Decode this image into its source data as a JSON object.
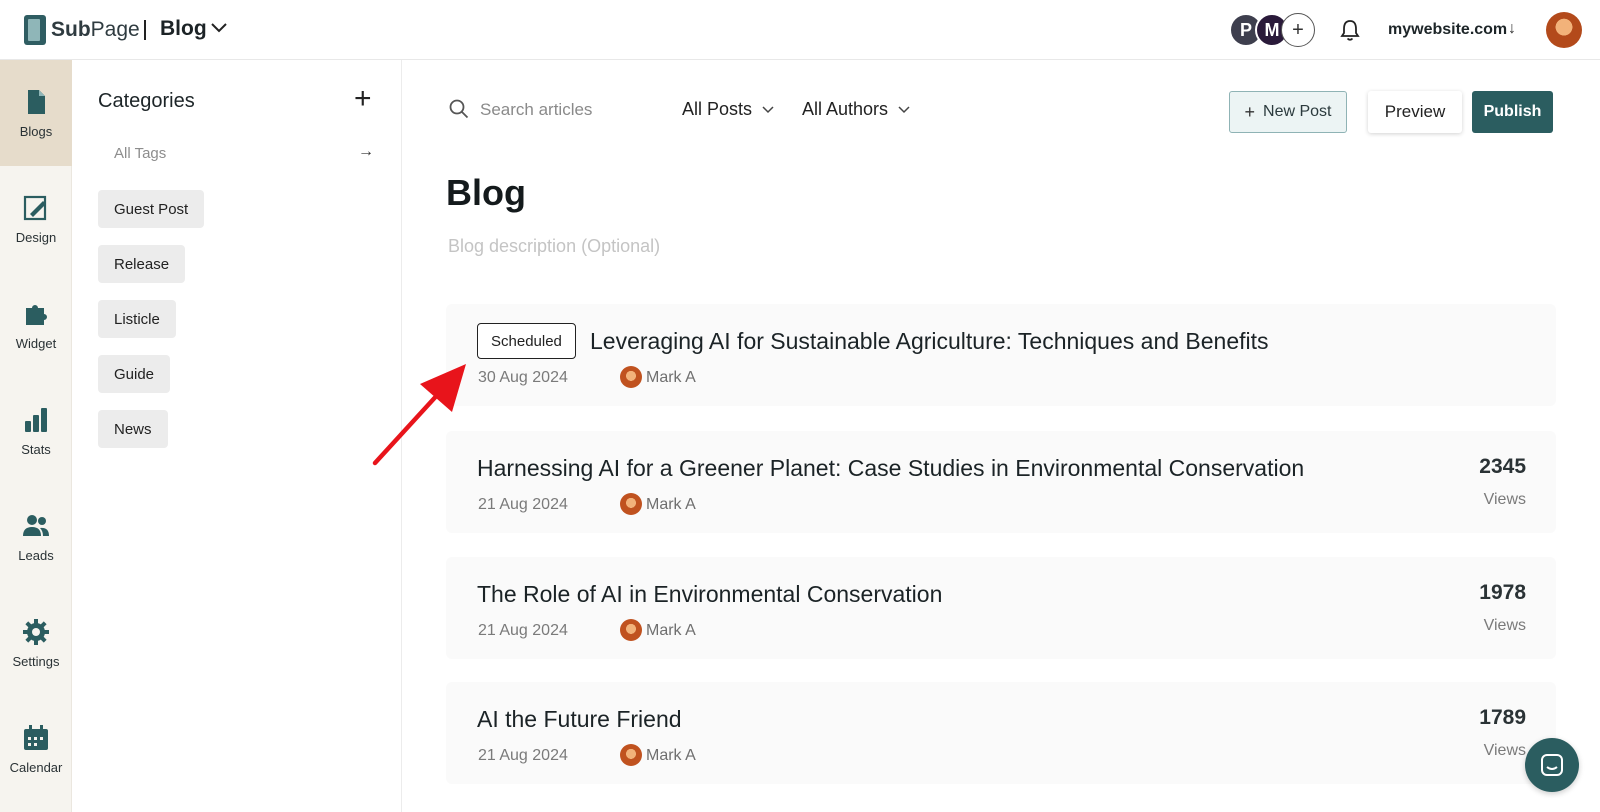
{
  "brand": {
    "logo_text_bold": "Sub",
    "logo_text_light": "Page"
  },
  "header": {
    "site_title": "Blog",
    "avatars": [
      "P",
      "M",
      "+"
    ],
    "domain": "mywebsite.com",
    "domain_arrow": "↓"
  },
  "rail": {
    "items": [
      {
        "label": "Blogs",
        "icon": "document-icon"
      },
      {
        "label": "Design",
        "icon": "design-icon"
      },
      {
        "label": "Widget",
        "icon": "puzzle-icon"
      },
      {
        "label": "Stats",
        "icon": "bar-chart-icon"
      },
      {
        "label": "Leads",
        "icon": "users-icon"
      },
      {
        "label": "Settings",
        "icon": "gear-icon"
      },
      {
        "label": "Calendar",
        "icon": "calendar-icon"
      }
    ]
  },
  "categories": {
    "title": "Categories",
    "add": "+",
    "all_tags": "All Tags",
    "all_tags_arrow": "→",
    "tags": [
      "Guest Post",
      "Release",
      "Listicle",
      "Guide",
      "News"
    ]
  },
  "toolbar": {
    "search_placeholder": "Search articles",
    "filter_posts": "All Posts",
    "filter_authors": "All Authors",
    "new_post": "New Post",
    "preview": "Preview",
    "publish": "Publish"
  },
  "page": {
    "title": "Blog",
    "description_placeholder": "Blog description (Optional)"
  },
  "posts": [
    {
      "status": "Scheduled",
      "title": "Leveraging AI for Sustainable Agriculture: Techniques and Benefits",
      "date": "30 Aug 2024",
      "author": "Mark A",
      "views": null,
      "views_label": null
    },
    {
      "status": null,
      "title": "Harnessing AI for a Greener Planet: Case Studies in Environmental Conservation",
      "date": "21 Aug 2024",
      "author": "Mark A",
      "views": "2345",
      "views_label": "Views"
    },
    {
      "status": null,
      "title": "The Role of AI in Environmental Conservation",
      "date": "21 Aug 2024",
      "author": "Mark A",
      "views": "1978",
      "views_label": "Views"
    },
    {
      "status": null,
      "title": "AI the Future Friend",
      "date": "21 Aug 2024",
      "author": "Mark A",
      "views": "1789",
      "views_label": "Views"
    }
  ],
  "colors": {
    "accent": "#2b5d60",
    "rail_bg": "#f6f4ef",
    "rail_active": "#e6dccb",
    "annotation_arrow": "#e8141b"
  }
}
